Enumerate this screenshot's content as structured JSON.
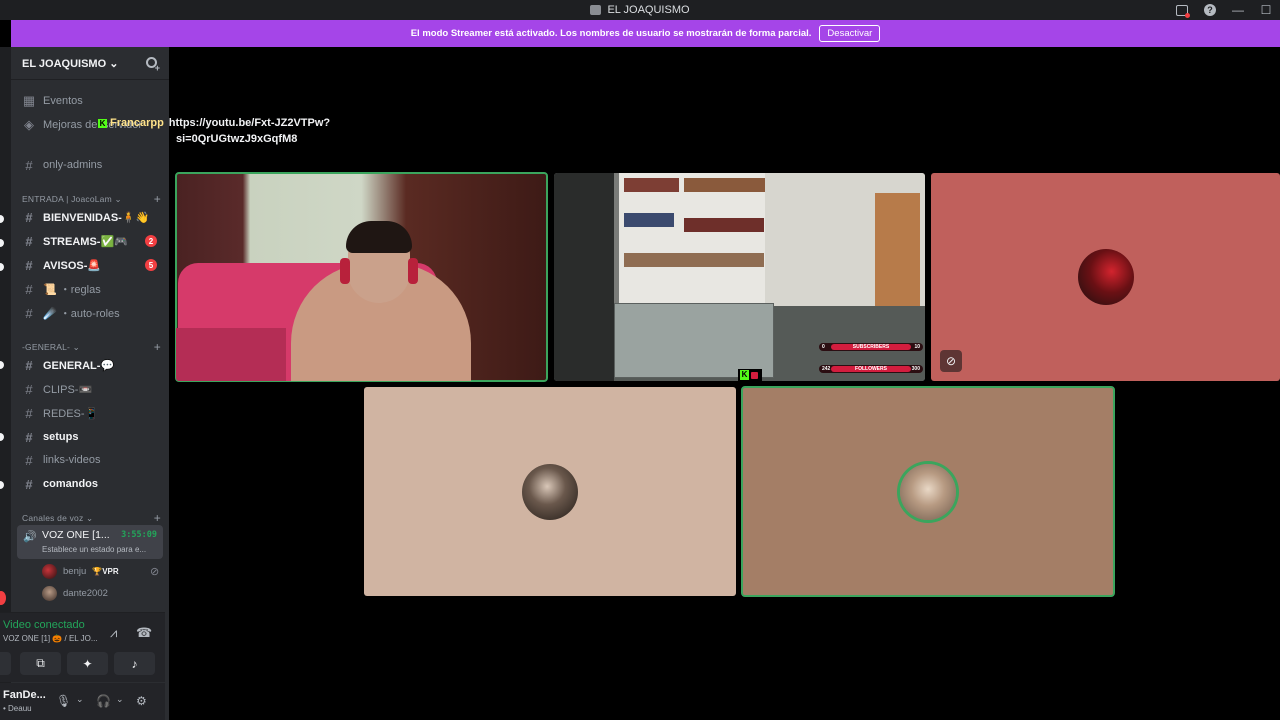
{
  "window": {
    "title": "EL JOAQUISMO"
  },
  "streamer_banner": {
    "message": "El modo Streamer está activado. Los nombres de usuario se mostrarán de forma parcial.",
    "button_label": "Desactivar",
    "color": "#a545e8"
  },
  "server": {
    "name": "EL JOAQUISMO ⌄"
  },
  "sidebar": {
    "top_items": [
      {
        "label": "Eventos",
        "icon": "calendar-icon"
      },
      {
        "label": "Mejoras del servidor",
        "icon": "boost-icon"
      }
    ],
    "only_admins": "only-admins",
    "categories": {
      "entrada": "ENTRADA | JoacoLam ⌄",
      "general": "-GENERAL- ⌄",
      "voz": "Canales de voz ⌄"
    },
    "channels": [
      {
        "label": "BIENVENIDAS-🧍👋",
        "unread": true
      },
      {
        "label": "STREAMS-✅🎮",
        "unread": true,
        "badge": "2"
      },
      {
        "label": "AVISOS-🚨",
        "unread": true,
        "badge": "5"
      },
      {
        "label": "📜 ・reglas",
        "unread": false
      },
      {
        "label": "☄️ ・auto-roles",
        "unread": false
      },
      {
        "label": "GENERAL-💬",
        "unread": true
      },
      {
        "label": "CLIPS-📼",
        "unread": false
      },
      {
        "label": "REDES-📱",
        "unread": false
      },
      {
        "label": "setups",
        "unread": true
      },
      {
        "label": "links-videos",
        "unread": false
      },
      {
        "label": "comandos",
        "unread": true
      }
    ],
    "voice_channel": {
      "name": "VOZ ONE [1...",
      "timer": "3:55:09",
      "status": "Establece un estado para e..."
    },
    "voice_users": [
      {
        "name": "benju",
        "tag": "🏆VPR"
      },
      {
        "name": "dante2002",
        "tag": ""
      }
    ]
  },
  "rtc_panel": {
    "status": "Video conectado",
    "location": "VOZ ONE [1] 🎃 / EL JO..."
  },
  "user_panel": {
    "username": "FanDe...",
    "status": "• Deauu"
  },
  "chat_overlay": {
    "username": "Francarpp",
    "message_line1": "https://youtu.be/Fxt-JZ2VTPw?",
    "message_line2": "si=0QrUGtwzJ9xGqfM8"
  },
  "stream_overlay": {
    "subscribers_label": "SUBSCRIBERS",
    "subscribers_current": "0",
    "subscribers_goal": "10",
    "followers_label": "FOLLOWERS",
    "followers_current": "242",
    "followers_goal": "300"
  },
  "colors": {
    "speaking_ring": "#3ba55d",
    "tile3": "#c0605c",
    "tile4": "#d0b4a2",
    "tile5": "#a47e66"
  }
}
